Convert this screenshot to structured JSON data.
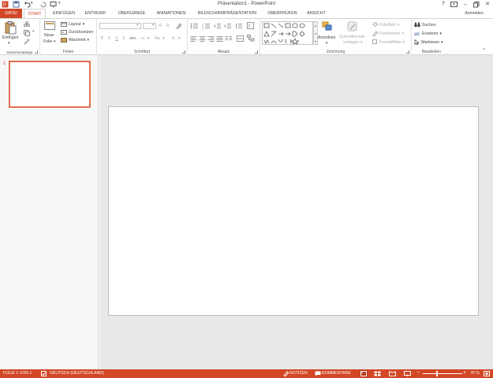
{
  "app": {
    "title": "Präsentation1 - PowerPoint",
    "user": "Anmelden",
    "help": "?"
  },
  "tabs": [
    "DATEI",
    "START",
    "EINFÜGEN",
    "ENTWURF",
    "ÜBERGÄNGE",
    "ANIMATIONEN",
    "BILDSCHIRMPRÄSENTATION",
    "ÜBERPRÜFEN",
    "ANSICHT"
  ],
  "ribbon": {
    "clipboard": {
      "paste": "Einfügen",
      "label": "Zwischenablage"
    },
    "slides": {
      "new_slide_1": "Neue",
      "new_slide_2": "Folie",
      "layout": "Layout",
      "reset": "Zurücksetzen",
      "section": "Abschnitt",
      "label": "Folien"
    },
    "font": {
      "bold": "F",
      "italic": "K",
      "underline": "U",
      "strike": "S",
      "shadow": "abc",
      "spacing": "AV",
      "case": "Aa",
      "color": "A",
      "grow": "A",
      "shrink": "A",
      "label": "Schriftart"
    },
    "paragraph": {
      "label": "Absatz"
    },
    "drawing": {
      "arrange": "Anordnen",
      "quickstyles_1": "Schnellformat-",
      "quickstyles_2": "vorlagen",
      "fill": "Fülleffekt",
      "outline": "Formkontur",
      "effects": "Formeffekte",
      "label": "Zeichnung"
    },
    "editing": {
      "find": "Suchen",
      "replace": "Ersetzen",
      "select": "Markieren",
      "label": "Bearbeiten"
    }
  },
  "slides_panel": {
    "number": "1"
  },
  "status": {
    "slide": "FOLIE 1 VON 1",
    "language": "DEUTSCH (DEUTSCHLAND)",
    "notes": "NOTIZEN",
    "comments": "KOMMENTARE",
    "zoom": "76 %",
    "minus": "−",
    "plus": "+"
  },
  "colors": {
    "accent": "#d24726",
    "ribbon_bg": "#ffffff",
    "canvas_bg": "#e8e8e8"
  }
}
